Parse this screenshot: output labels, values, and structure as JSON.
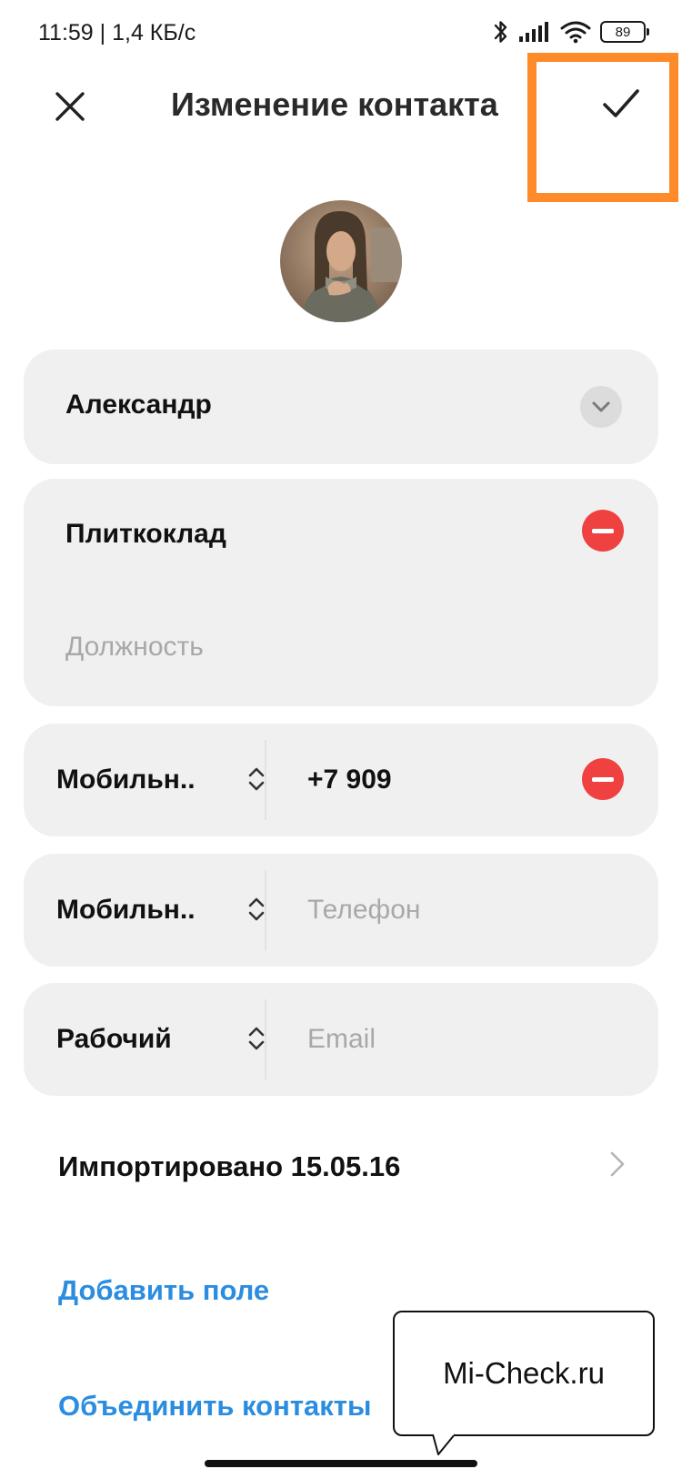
{
  "status_bar": {
    "time": "11:59 | 1,4 КБ/с",
    "battery": "89",
    "icons": [
      "bluetooth-icon",
      "signal-icon",
      "wifi-icon",
      "battery-icon"
    ]
  },
  "header": {
    "title": "Изменение контакта",
    "close_icon": "close-icon",
    "confirm_icon": "check-icon",
    "highlight_color": "#ff8a2a"
  },
  "form": {
    "first_name": "Александр",
    "company": "Плиткоклад",
    "job_title_placeholder": "Должность",
    "phone_1": {
      "type": "Мобильн..",
      "value": "+7 909"
    },
    "phone_2": {
      "type": "Мобильн..",
      "placeholder": "Телефон"
    },
    "email": {
      "type": "Рабочий",
      "placeholder": "Email"
    }
  },
  "import_row": {
    "label": "Импортировано 15.05.16"
  },
  "links": {
    "add_field": "Добавить поле",
    "merge_contacts": "Объединить контакты"
  },
  "callout": {
    "text": "Mi-Check.ru"
  },
  "colors": {
    "accent_link": "#2a8de0",
    "remove": "#f04141",
    "card_bg": "#f0f0f0"
  }
}
